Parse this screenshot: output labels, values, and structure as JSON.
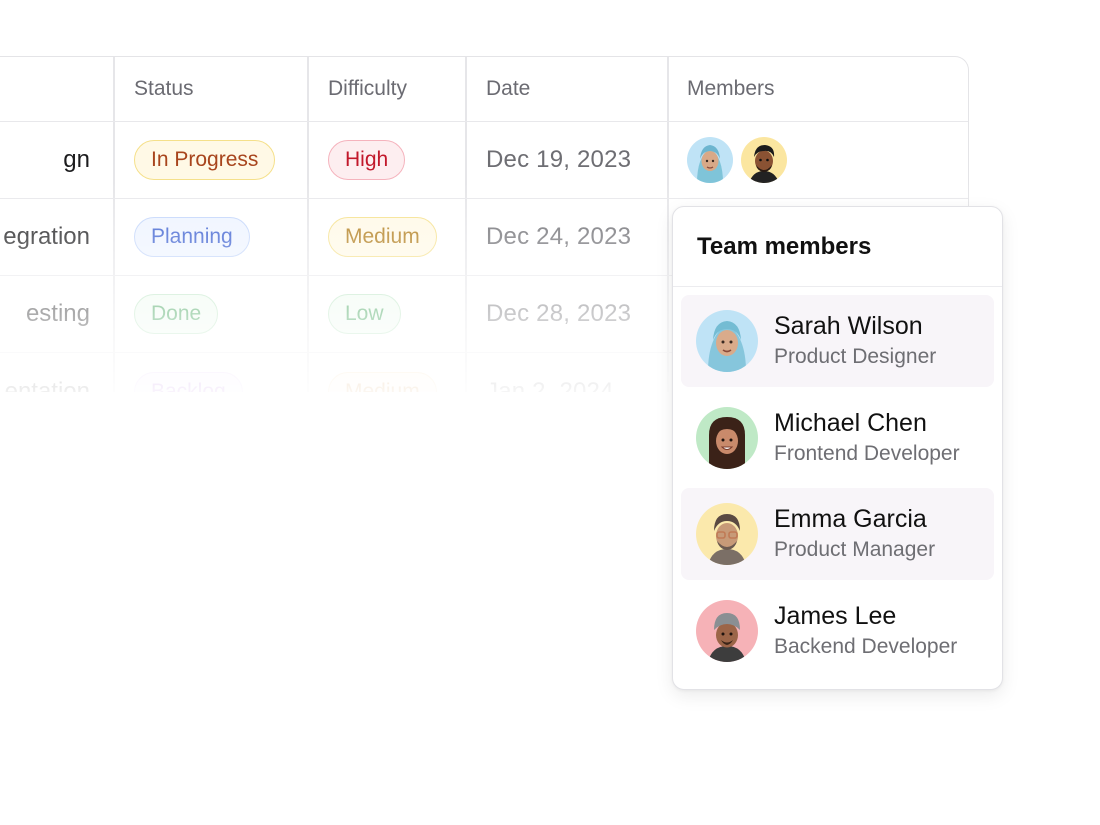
{
  "table": {
    "headers": {
      "status": "Status",
      "difficulty": "Difficulty",
      "date": "Date",
      "members": "Members"
    },
    "rows": [
      {
        "task": "gn",
        "status": "In Progress",
        "difficulty": "High",
        "date": "Dec 19, 2023"
      },
      {
        "task": "egration",
        "status": "Planning",
        "difficulty": "Medium",
        "date": "Dec 24, 2023"
      },
      {
        "task": "esting",
        "status": "Done",
        "difficulty": "Low",
        "date": "Dec 28, 2023"
      },
      {
        "task": "entation",
        "status": "Backlog",
        "difficulty": "Medium",
        "date": "Jan 2, 2024"
      }
    ]
  },
  "popover": {
    "title": "Team members",
    "members": [
      {
        "name": "Sarah Wilson",
        "role": "Product Designer",
        "avatar_bg": "#bfe3f6"
      },
      {
        "name": "Michael Chen",
        "role": "Frontend Developer",
        "avatar_bg": "#bfe9c6"
      },
      {
        "name": "Emma Garcia",
        "role": "Product Manager",
        "avatar_bg": "#fbe9ac"
      },
      {
        "name": "James Lee",
        "role": "Backend Developer",
        "avatar_bg": "#f6b2b7"
      }
    ]
  },
  "colors": {
    "border": "#e4e4e7",
    "row_hover": "#f8f5f9",
    "muted_text": "#6e6e73"
  }
}
